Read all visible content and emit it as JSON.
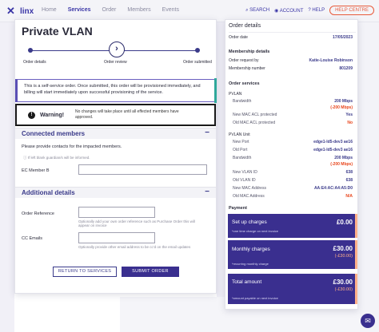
{
  "app": {
    "logo_text": "linx",
    "nav": [
      "Home",
      "Services",
      "Order",
      "Members",
      "Events"
    ],
    "nav_active": "Services",
    "search_label": "SEARCH",
    "account_label": "ACCOUNT",
    "help_label": "HELP",
    "contact_label": "HELP CENTRE"
  },
  "page": {
    "title": "Private VLAN",
    "steps": [
      "Order details",
      "Order review",
      "Order submitted"
    ],
    "info": "This is a self-service order. Once submitted, this order will be provisioned immediately, and billing will start immediately upon successful provisioning of the service.",
    "warning_title": "Warning!",
    "warning_text": "No changes will take place until all effected members have approved."
  },
  "connected": {
    "heading": "Connected members",
    "toggle": "−",
    "instruction": "Please provide contacts for the impacted members.",
    "hint": "If left blank guardian/s will be informed.",
    "field_label": "EC Member B",
    "field_value": ""
  },
  "additional": {
    "heading": "Additional details",
    "toggle": "−",
    "order_ref_label": "Order Reference",
    "order_ref_value": "",
    "order_ref_hint": "Optionally add your own order reference such as Purchase Order this will appear on invoice",
    "cc_label": "CC Emails",
    "cc_value": "",
    "cc_hint": "Optionally provide other email address to be cc'd on the email updates"
  },
  "buttons": {
    "return": "RETURN TO SERVICES",
    "submit": "SUBMIT ORDER"
  },
  "order_details": {
    "title": "Order details",
    "order_date_label": "Order date",
    "order_date": "17/05/2023",
    "membership_heading": "Membership details",
    "order_request_label": "Order request by",
    "order_request": "Katie-Louise Robinson",
    "membership_number_label": "Membership number",
    "membership_number": "801209",
    "services_heading": "Order services",
    "pvlan_label": "PVLAN",
    "bandwidth_label": "Bandwidth",
    "bandwidth": "200 Mbps",
    "bandwidth_disc": "(-200 Mbps)",
    "new_mac_label": "New MAC ACL protected",
    "new_mac": "Yes",
    "old_mac_label": "Old MAC ACL protected",
    "old_mac": "No",
    "unit_label": "PVLAN Unit",
    "new_port_label": "New Port",
    "new_port": "edge1-ld5-dev3 ae16",
    "old_port_label": "Old Port",
    "old_port": "edge1-ld5-dev3 ae16",
    "bandwidth2": "200 Mbps",
    "bandwidth2_disc": "(-200 Mbps)",
    "new_vlan_label": "New VLAN ID",
    "new_vlan": "638",
    "old_vlan_label": "Old VLAN ID",
    "old_vlan": "638",
    "new_mac_addr_label": "New MAC Address",
    "new_mac_addr": "AA:E4:AC:A4:A5:D0",
    "old_mac_addr_label": "Old MAC Address",
    "old_mac_addr": "N/A",
    "payment_heading": "Payment"
  },
  "payment": {
    "setup_label": "Set up charges",
    "setup_amount": "£0.00",
    "setup_note": "*one time charge on next invoice",
    "monthly_label": "Monthly charges",
    "monthly_amount": "£30.00",
    "monthly_disc": "(-£30.00)",
    "monthly_note": "*recurring monthly charge",
    "total_label": "Total amount",
    "total_amount": "£30.00",
    "total_disc": "(-£30.00)",
    "total_note": "*amount payable on next invoice"
  },
  "colors": {
    "brand": "#3a2f8f",
    "accent": "#e8441a",
    "teal": "#2fa89a"
  }
}
